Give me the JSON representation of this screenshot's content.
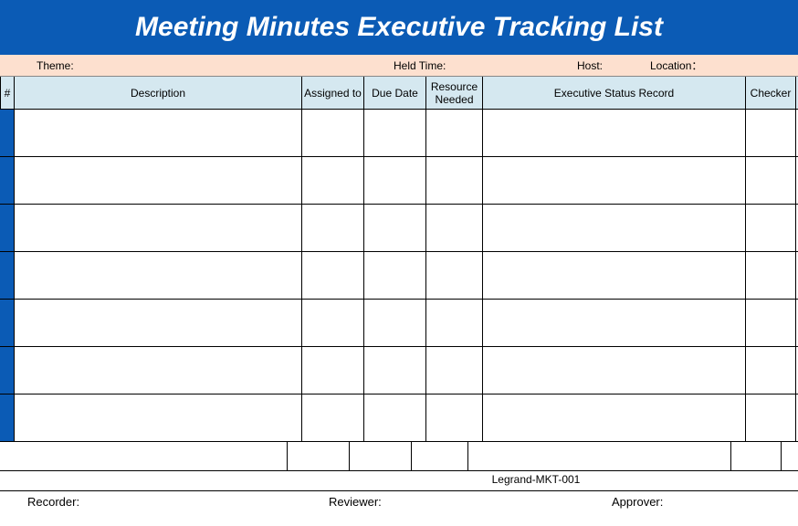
{
  "title": "Meeting Minutes Executive Tracking List",
  "meta": {
    "theme_label": "Theme:",
    "held_time_label": "Held Time:",
    "host_label": "Host:",
    "location_label": "Location："
  },
  "columns": {
    "num": "#",
    "description": "Description",
    "assigned_to": "Assigned to",
    "due_date": "Due Date",
    "resource_needed": "Resource Needed",
    "status_record": "Executive Status Record",
    "checker": "Checker"
  },
  "footer": {
    "doc_id": "Legrand-MKT-001",
    "recorder_label": "Recorder:",
    "reviewer_label": "Reviewer:",
    "approver_label": "Approver:"
  }
}
